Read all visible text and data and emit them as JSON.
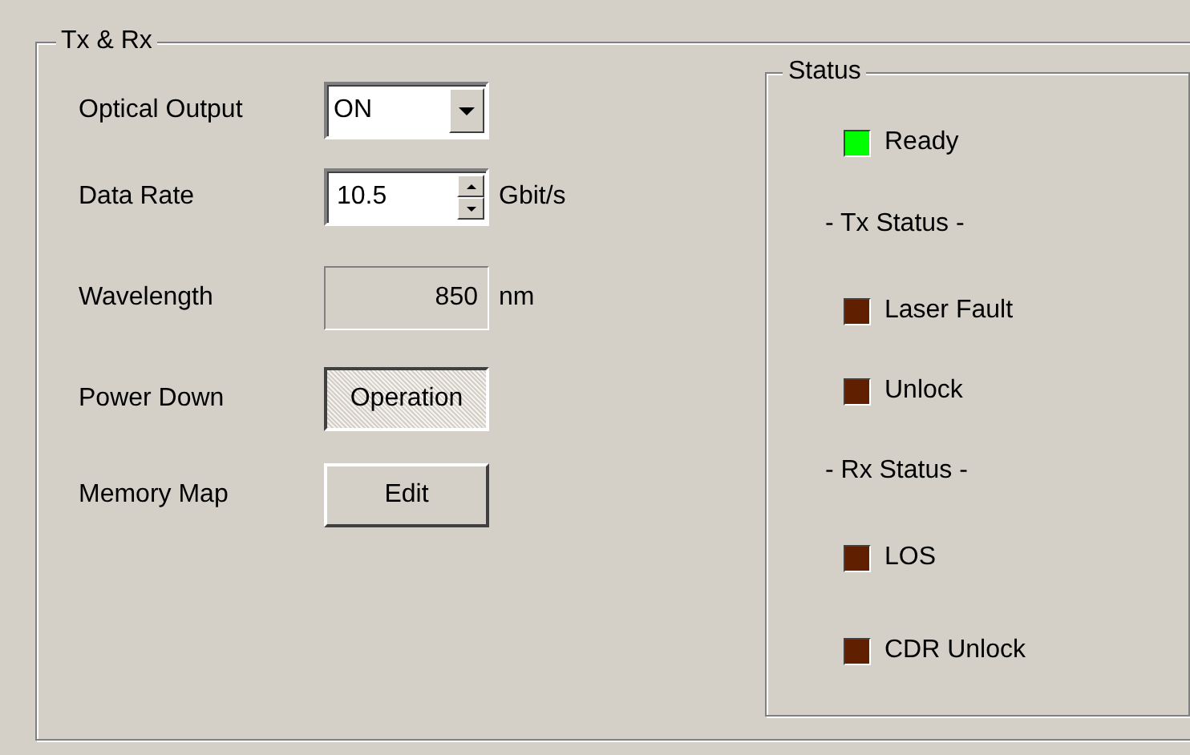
{
  "group": {
    "title": "Tx & Rx"
  },
  "settings": [
    {
      "label": "Optical Output",
      "kind": "dropdown",
      "value": "ON"
    },
    {
      "label": "Data Rate",
      "kind": "spinner",
      "value": "10.5",
      "unit": "Gbit/s"
    },
    {
      "label": "Wavelength",
      "kind": "readonly",
      "value": "850",
      "unit": "nm"
    },
    {
      "label": "Power Down",
      "kind": "toggle",
      "value": "Operation",
      "pressed": true
    },
    {
      "label": "Memory Map",
      "kind": "button",
      "value": "Edit"
    }
  ],
  "status": {
    "title": "Status",
    "items": [
      {
        "kind": "led",
        "label": "Ready",
        "color": "#00ff00"
      },
      {
        "kind": "heading",
        "label": "- Tx Status -"
      },
      {
        "kind": "led",
        "label": "Laser Fault",
        "color": "#602000"
      },
      {
        "kind": "led",
        "label": "Unlock",
        "color": "#602000"
      },
      {
        "kind": "heading",
        "label": "- Rx Status -"
      },
      {
        "kind": "led",
        "label": "LOS",
        "color": "#602000"
      },
      {
        "kind": "led",
        "label": "CDR Unlock",
        "color": "#602000"
      }
    ]
  }
}
